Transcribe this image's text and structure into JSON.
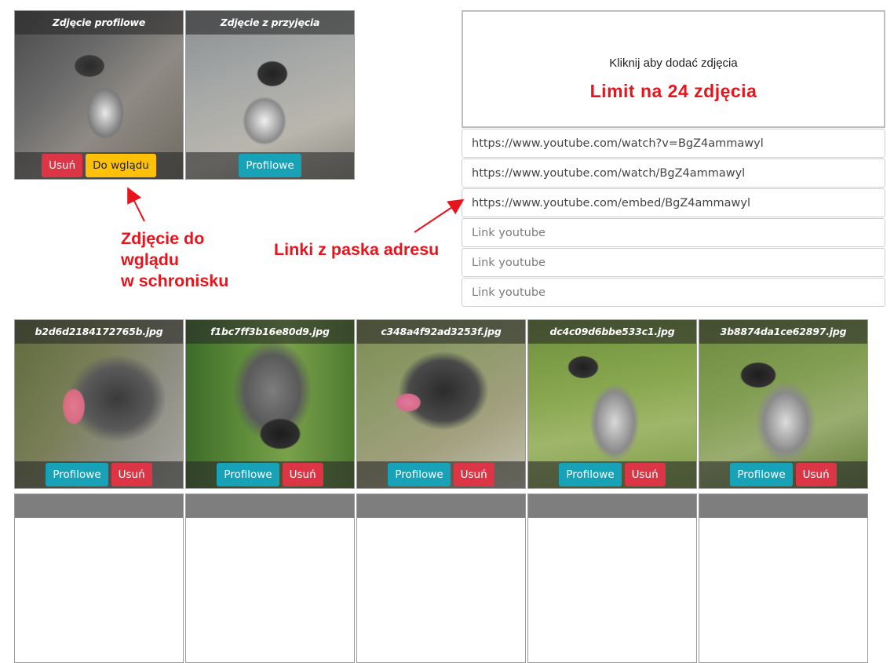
{
  "top_cards": [
    {
      "title": "Zdjęcie profilowe",
      "buttons": [
        {
          "label": "Usuń",
          "kind": "red"
        },
        {
          "label": "Do wglądu",
          "kind": "yellow"
        }
      ]
    },
    {
      "title": "Zdjęcie z przyjęcia",
      "buttons": [
        {
          "label": "Profilowe",
          "kind": "teal"
        }
      ]
    }
  ],
  "upload": {
    "prompt": "Kliknij aby dodać zdjęcia",
    "limit": "Limit na 24 zdjęcia"
  },
  "youtube_links": [
    {
      "value": "https://www.youtube.com/watch?v=BgZ4ammawyl",
      "placeholder": "Link youtube"
    },
    {
      "value": "https://www.youtube.com/watch/BgZ4ammawyl",
      "placeholder": "Link youtube"
    },
    {
      "value": "https://www.youtube.com/embed/BgZ4ammawyl",
      "placeholder": "Link youtube"
    },
    {
      "value": "",
      "placeholder": "Link youtube"
    },
    {
      "value": "",
      "placeholder": "Link youtube"
    },
    {
      "value": "",
      "placeholder": "Link youtube"
    }
  ],
  "annotations": {
    "photo_note": [
      "Zdjęcie do",
      "wglądu",
      "w schronisku"
    ],
    "links_note": "Linki z paska adresu"
  },
  "gallery": [
    {
      "title": "b2d6d2184172765b.jpg",
      "buttons": [
        {
          "label": "Profilowe"
        },
        {
          "label": "Usuń"
        }
      ]
    },
    {
      "title": "f1bc7ff3b16e80d9.jpg",
      "buttons": [
        {
          "label": "Profilowe"
        },
        {
          "label": "Usuń"
        }
      ]
    },
    {
      "title": "c348a4f92ad3253f.jpg",
      "buttons": [
        {
          "label": "Profilowe"
        },
        {
          "label": "Usuń"
        }
      ]
    },
    {
      "title": "dc4c09d6bbe533c1.jpg",
      "buttons": [
        {
          "label": "Profilowe"
        },
        {
          "label": "Usuń"
        }
      ]
    },
    {
      "title": "3b8874da1ce62897.jpg",
      "buttons": [
        {
          "label": "Profilowe"
        },
        {
          "label": "Usuń"
        }
      ]
    }
  ],
  "colors": {
    "danger": "#dc3545",
    "warning": "#ffc107",
    "info": "#17a2b8",
    "annotation": "#e8141c"
  }
}
